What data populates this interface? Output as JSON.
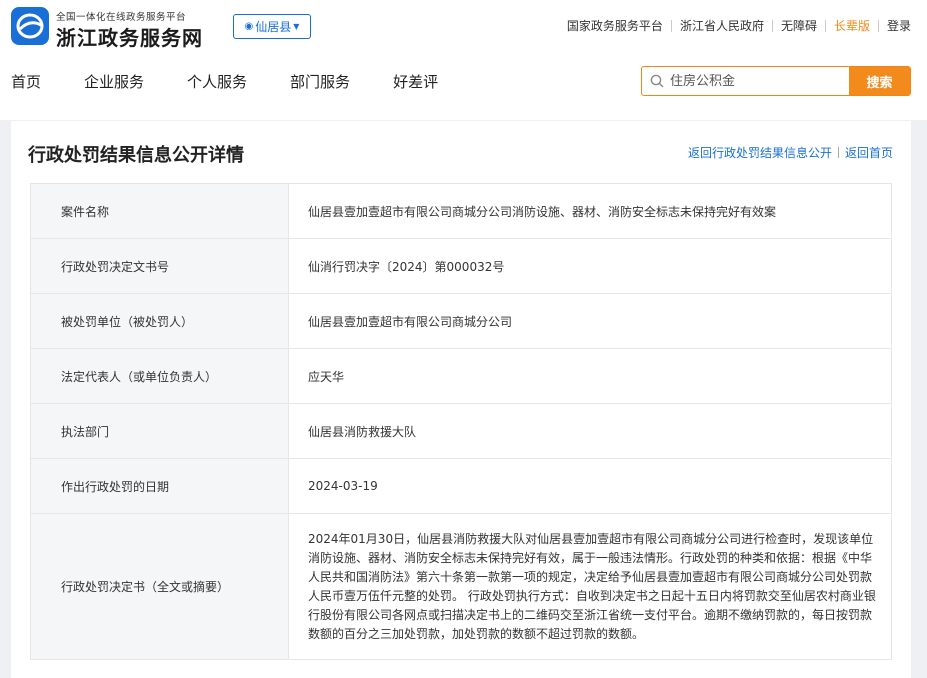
{
  "header": {
    "logo_subtitle": "全国一体化在线政务服务平台",
    "logo_title": "浙江政务服务网",
    "region": "仙居县",
    "top_links": [
      {
        "label": "国家政务服务平台"
      },
      {
        "label": "浙江省人民政府"
      },
      {
        "label": "无障碍"
      },
      {
        "label": "长辈版"
      },
      {
        "label": "登录"
      }
    ]
  },
  "nav": {
    "items": [
      "首页",
      "企业服务",
      "个人服务",
      "部门服务",
      "好差评"
    ]
  },
  "search": {
    "placeholder": "住房公积金",
    "button_label": "搜索"
  },
  "page": {
    "title": "行政处罚结果信息公开详情",
    "back_list_link": "返回行政处罚结果信息公开",
    "back_home_link": "返回首页"
  },
  "details": [
    {
      "label": "案件名称",
      "value": "仙居县壹加壹超市有限公司商城分公司消防设施、器材、消防安全标志未保持完好有效案"
    },
    {
      "label": "行政处罚决定文书号",
      "value": "仙消行罚决字〔2024〕第000032号"
    },
    {
      "label": "被处罚单位（被处罚人）",
      "value": "仙居县壹加壹超市有限公司商城分公司"
    },
    {
      "label": "法定代表人（或单位负责人）",
      "value": "应天华"
    },
    {
      "label": "执法部门",
      "value": "仙居县消防救援大队"
    },
    {
      "label": "作出行政处罚的日期",
      "value": "2024-03-19"
    },
    {
      "label": "行政处罚决定书（全文或摘要）",
      "value": "2024年01月30日，仙居县消防救援大队对仙居县壹加壹超市有限公司商城分公司进行检查时，发现该单位消防设施、器材、消防安全标志未保持完好有效，属于一般违法情形。行政处罚的种类和依据：根据《中华人民共和国消防法》第六十条第一款第一项的规定，决定给予仙居县壹加壹超市有限公司商城分公司处罚款人民币壹万伍仟元整的处罚。 行政处罚执行方式：自收到决定书之日起十五日内将罚款交至仙居农村商业银行股份有限公司各网点或扫描决定书上的二维码交至浙江省统一支付平台。逾期不缴纳罚款的，每日按罚款数额的百分之三加处罚款，加处罚款的数额不超过罚款的数额。"
    }
  ],
  "colors": {
    "brand_blue": "#1a6fd6",
    "accent_orange": "#f28a1c"
  }
}
